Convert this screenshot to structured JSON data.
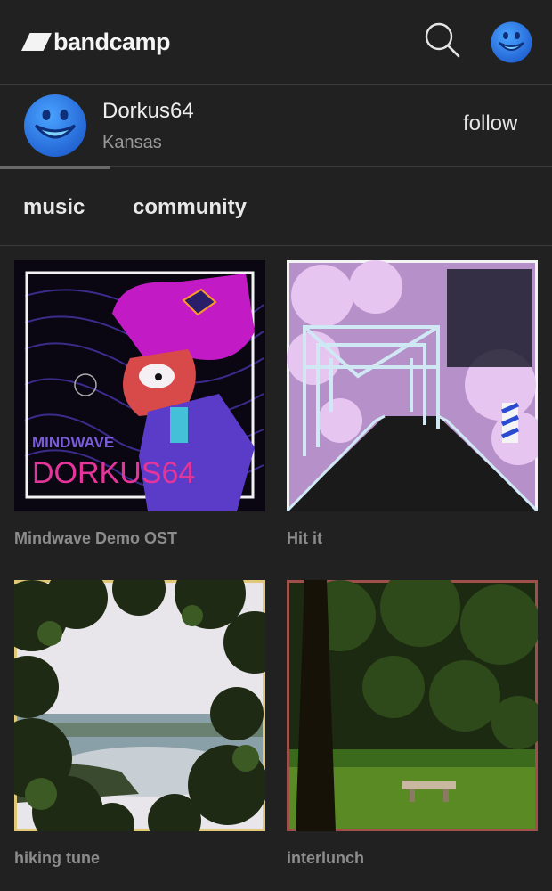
{
  "header": {
    "logo_text": "bandcamp",
    "search_icon": "search-icon",
    "avatar_icon": "smiley-avatar-icon"
  },
  "profile": {
    "name": "Dorkus64",
    "location": "Kansas",
    "follow_label": "follow"
  },
  "tabs": [
    {
      "label": "music"
    },
    {
      "label": "community"
    }
  ],
  "albums": [
    {
      "title": "Mindwave Demo OST",
      "cover_text_1": "MINDWAVE",
      "cover_text_2": "DORKUS64"
    },
    {
      "title": "Hit it"
    },
    {
      "title": "hiking tune"
    },
    {
      "title": "interlunch"
    }
  ],
  "colors": {
    "background": "#212121",
    "divider": "#3b3b3b",
    "avatar_blue": "#2f7fe0",
    "muted_text": "#8c8c8c"
  }
}
